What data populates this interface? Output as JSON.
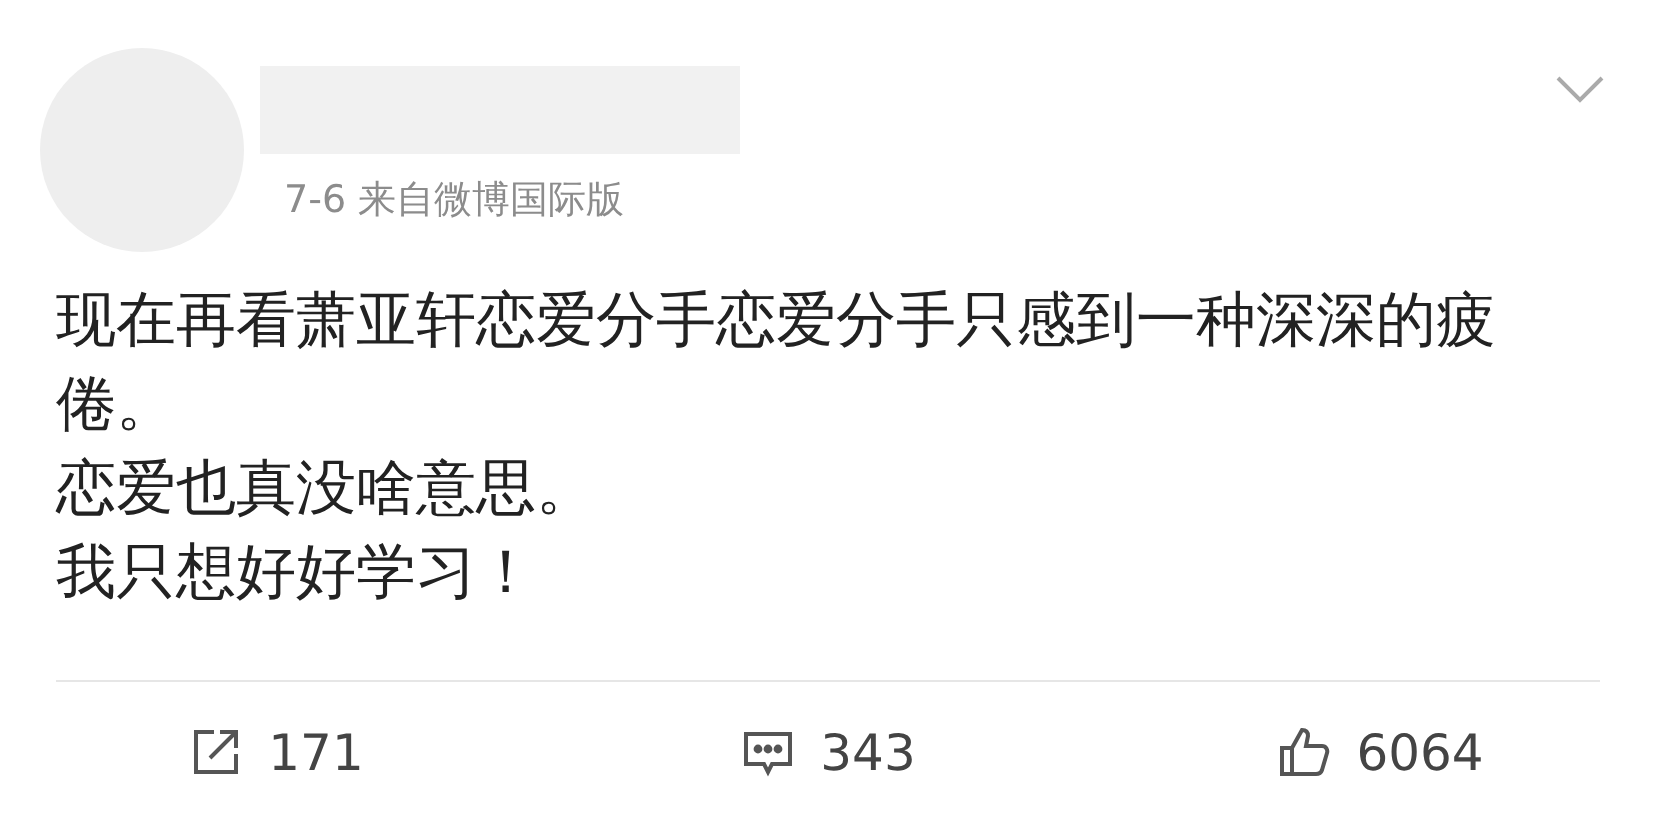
{
  "post": {
    "meta": "7-6 来自微博国际版",
    "paragraphs": [
      "现在再看萧亚轩恋爱分手恋爱分手只感到一种深深的疲倦。",
      "恋爱也真没啥意思。",
      "我只想好好学习！"
    ]
  },
  "actions": [
    {
      "kind": "share",
      "count": "171"
    },
    {
      "kind": "comment",
      "count": "343"
    },
    {
      "kind": "like",
      "count": "6064"
    }
  ]
}
